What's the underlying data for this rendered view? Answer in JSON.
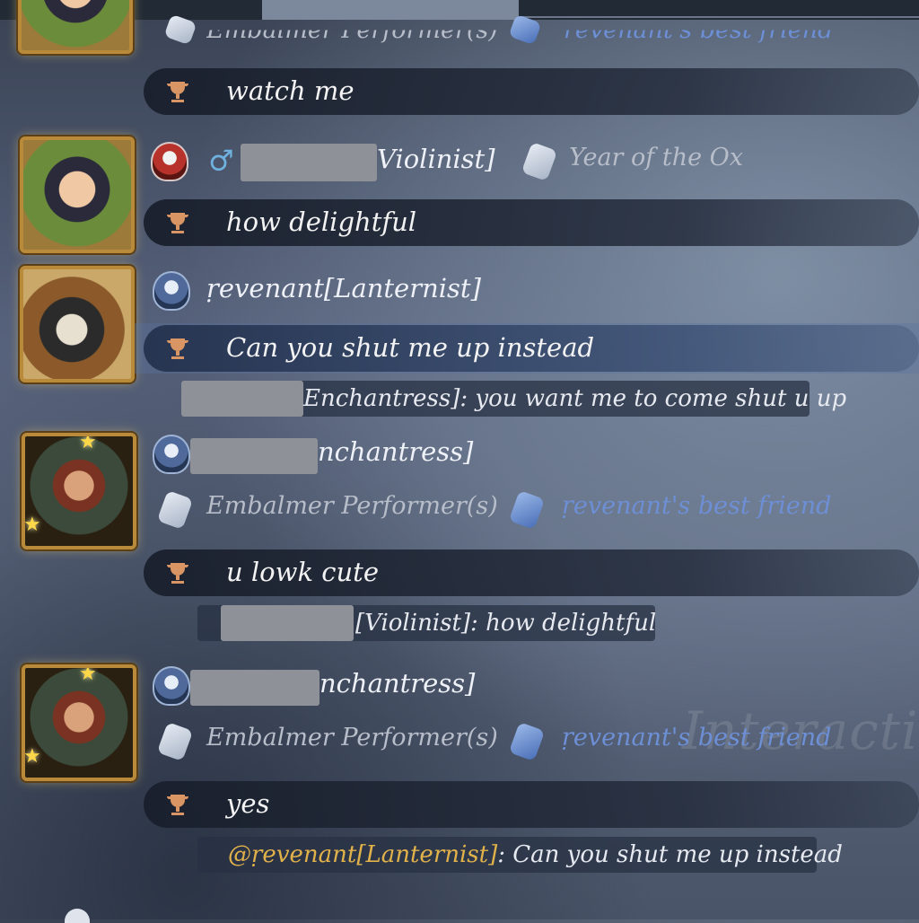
{
  "messages": [
    {
      "partial_name": "Embalmer Performer(s)",
      "partial_tag": "revenant's best friend",
      "text": "watch me"
    },
    {
      "name_suffix": "Violinist]",
      "gender": "♂",
      "tag": "Year of the Ox",
      "text": "how delightful"
    },
    {
      "name": "ṛevenant[Lanternist]",
      "text": "Can you shut me up instead",
      "reply": "Enchantress]: you want me to come shut u up"
    },
    {
      "name_suffix": "nchantress]",
      "tag1": "Embalmer Performer(s)",
      "tag2": "ṛevenant's best friend",
      "text": "u lowk cute",
      "reply": "[Violinist]: how delightful"
    },
    {
      "name_suffix": "nchantress]",
      "tag1": "Embalmer Performer(s)",
      "tag2": "ṛevenant's best friend",
      "text": "yes",
      "reply_mention": "@ṛevenant[Lanternist]",
      "reply_rest": ": Can you shut me up instead"
    }
  ],
  "watermark": "Interactio",
  "colors": {
    "mention": "#e2b24a",
    "tag_blue": "#6d8fd6",
    "tag_grey": "#b7bdc9",
    "trophy": "#d99563"
  }
}
